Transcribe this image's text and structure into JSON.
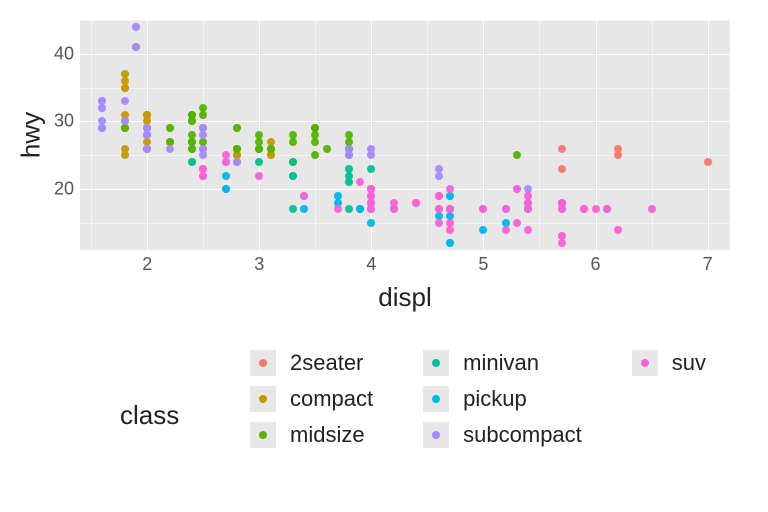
{
  "chart_data": {
    "type": "scatter",
    "title": "",
    "xlabel": "displ",
    "ylabel": "hwy",
    "xlim": [
      1.4,
      7.2
    ],
    "ylim": [
      11,
      45
    ],
    "x_breaks": [
      2,
      3,
      4,
      5,
      6,
      7
    ],
    "y_breaks": [
      20,
      30,
      40
    ],
    "legend_title": "class",
    "colors": {
      "2seater": "#F8766D",
      "compact": "#C49A00",
      "midsize": "#53B400",
      "minivan": "#00C094",
      "pickup": "#00B6EB",
      "subcompact": "#A58AFF",
      "suv": "#FB61D7"
    },
    "series": [
      {
        "name": "2seater",
        "points": [
          {
            "x": 5.7,
            "y": 26
          },
          {
            "x": 5.7,
            "y": 23
          },
          {
            "x": 6.2,
            "y": 26
          },
          {
            "x": 6.2,
            "y": 25
          },
          {
            "x": 7.0,
            "y": 24
          }
        ]
      },
      {
        "name": "compact",
        "points": [
          {
            "x": 1.8,
            "y": 29
          },
          {
            "x": 1.8,
            "y": 29
          },
          {
            "x": 2.0,
            "y": 31
          },
          {
            "x": 2.0,
            "y": 30
          },
          {
            "x": 2.8,
            "y": 26
          },
          {
            "x": 2.8,
            "y": 26
          },
          {
            "x": 3.1,
            "y": 27
          },
          {
            "x": 1.8,
            "y": 26
          },
          {
            "x": 1.8,
            "y": 25
          },
          {
            "x": 2.0,
            "y": 28
          },
          {
            "x": 2.0,
            "y": 27
          },
          {
            "x": 2.8,
            "y": 25
          },
          {
            "x": 2.8,
            "y": 25
          },
          {
            "x": 3.1,
            "y": 25
          },
          {
            "x": 3.1,
            "y": 25
          },
          {
            "x": 2.4,
            "y": 24
          },
          {
            "x": 3.3,
            "y": 24
          },
          {
            "x": 2.0,
            "y": 26
          },
          {
            "x": 2.0,
            "y": 29
          },
          {
            "x": 2.0,
            "y": 29
          },
          {
            "x": 2.0,
            "y": 29
          },
          {
            "x": 2.0,
            "y": 28
          },
          {
            "x": 2.8,
            "y": 24
          },
          {
            "x": 1.9,
            "y": 44
          },
          {
            "x": 2.0,
            "y": 29
          },
          {
            "x": 2.0,
            "y": 26
          },
          {
            "x": 2.5,
            "y": 29
          },
          {
            "x": 1.8,
            "y": 29
          },
          {
            "x": 1.8,
            "y": 29
          },
          {
            "x": 1.8,
            "y": 30
          },
          {
            "x": 1.8,
            "y": 31
          },
          {
            "x": 2.0,
            "y": 26
          },
          {
            "x": 2.8,
            "y": 29
          },
          {
            "x": 1.9,
            "y": 41
          },
          {
            "x": 2.8,
            "y": 26
          },
          {
            "x": 2.2,
            "y": 27
          },
          {
            "x": 2.2,
            "y": 29
          },
          {
            "x": 2.4,
            "y": 31
          },
          {
            "x": 2.4,
            "y": 30
          },
          {
            "x": 3.0,
            "y": 26
          },
          {
            "x": 1.8,
            "y": 35
          },
          {
            "x": 1.8,
            "y": 36
          },
          {
            "x": 1.8,
            "y": 37
          },
          {
            "x": 1.8,
            "y": 35
          },
          {
            "x": 2.0,
            "y": 31
          },
          {
            "x": 2.0,
            "y": 31
          }
        ]
      },
      {
        "name": "midsize",
        "points": [
          {
            "x": 2.4,
            "y": 27
          },
          {
            "x": 2.4,
            "y": 30
          },
          {
            "x": 3.1,
            "y": 26
          },
          {
            "x": 3.5,
            "y": 29
          },
          {
            "x": 3.6,
            "y": 26
          },
          {
            "x": 2.4,
            "y": 26
          },
          {
            "x": 2.4,
            "y": 27
          },
          {
            "x": 2.4,
            "y": 28
          },
          {
            "x": 3.8,
            "y": 26
          },
          {
            "x": 3.8,
            "y": 28
          },
          {
            "x": 2.5,
            "y": 27
          },
          {
            "x": 2.5,
            "y": 26
          },
          {
            "x": 3.3,
            "y": 28
          },
          {
            "x": 2.5,
            "y": 31
          },
          {
            "x": 2.5,
            "y": 32
          },
          {
            "x": 3.0,
            "y": 27
          },
          {
            "x": 3.5,
            "y": 25
          },
          {
            "x": 3.0,
            "y": 26
          },
          {
            "x": 3.3,
            "y": 27
          },
          {
            "x": 2.2,
            "y": 29
          },
          {
            "x": 2.2,
            "y": 27
          },
          {
            "x": 2.4,
            "y": 31
          },
          {
            "x": 2.4,
            "y": 31
          },
          {
            "x": 3.0,
            "y": 26
          },
          {
            "x": 3.0,
            "y": 28
          },
          {
            "x": 3.5,
            "y": 28
          },
          {
            "x": 3.5,
            "y": 27
          },
          {
            "x": 2.8,
            "y": 26
          },
          {
            "x": 2.8,
            "y": 26
          },
          {
            "x": 2.8,
            "y": 29
          },
          {
            "x": 3.5,
            "y": 29
          },
          {
            "x": 5.3,
            "y": 25
          },
          {
            "x": 3.8,
            "y": 26
          },
          {
            "x": 3.8,
            "y": 25
          },
          {
            "x": 3.8,
            "y": 27
          },
          {
            "x": 1.8,
            "y": 29
          },
          {
            "x": 2.0,
            "y": 29
          },
          {
            "x": 2.4,
            "y": 27
          },
          {
            "x": 3.1,
            "y": 26
          },
          {
            "x": 3.5,
            "y": 29
          },
          {
            "x": 2.4,
            "y": 26
          }
        ]
      },
      {
        "name": "minivan",
        "points": [
          {
            "x": 2.4,
            "y": 24
          },
          {
            "x": 3.0,
            "y": 24
          },
          {
            "x": 3.3,
            "y": 22
          },
          {
            "x": 3.3,
            "y": 22
          },
          {
            "x": 3.3,
            "y": 24
          },
          {
            "x": 3.8,
            "y": 22
          },
          {
            "x": 3.8,
            "y": 21
          },
          {
            "x": 3.8,
            "y": 23
          },
          {
            "x": 4.0,
            "y": 23
          },
          {
            "x": 3.3,
            "y": 17
          },
          {
            "x": 3.8,
            "y": 17
          }
        ]
      },
      {
        "name": "pickup",
        "points": [
          {
            "x": 3.7,
            "y": 19
          },
          {
            "x": 3.7,
            "y": 18
          },
          {
            "x": 3.9,
            "y": 17
          },
          {
            "x": 3.9,
            "y": 17
          },
          {
            "x": 4.7,
            "y": 19
          },
          {
            "x": 4.7,
            "y": 19
          },
          {
            "x": 4.7,
            "y": 12
          },
          {
            "x": 5.2,
            "y": 17
          },
          {
            "x": 5.2,
            "y": 15
          },
          {
            "x": 5.7,
            "y": 17
          },
          {
            "x": 5.9,
            "y": 17
          },
          {
            "x": 4.7,
            "y": 16
          },
          {
            "x": 4.7,
            "y": 12
          },
          {
            "x": 4.7,
            "y": 17
          },
          {
            "x": 5.7,
            "y": 18
          },
          {
            "x": 6.1,
            "y": 17
          },
          {
            "x": 4.0,
            "y": 17
          },
          {
            "x": 4.0,
            "y": 20
          },
          {
            "x": 4.6,
            "y": 16
          },
          {
            "x": 5.0,
            "y": 14
          },
          {
            "x": 5.4,
            "y": 17
          },
          {
            "x": 2.7,
            "y": 20
          },
          {
            "x": 2.7,
            "y": 22
          },
          {
            "x": 2.7,
            "y": 20
          },
          {
            "x": 3.4,
            "y": 17
          },
          {
            "x": 3.4,
            "y": 19
          },
          {
            "x": 4.0,
            "y": 20
          },
          {
            "x": 4.0,
            "y": 15
          },
          {
            "x": 4.0,
            "y": 18
          },
          {
            "x": 5.4,
            "y": 18
          },
          {
            "x": 5.4,
            "y": 17
          },
          {
            "x": 4.7,
            "y": 17
          },
          {
            "x": 4.2,
            "y": 17
          }
        ]
      },
      {
        "name": "subcompact",
        "points": [
          {
            "x": 3.8,
            "y": 26
          },
          {
            "x": 3.8,
            "y": 25
          },
          {
            "x": 4.0,
            "y": 26
          },
          {
            "x": 4.0,
            "y": 25
          },
          {
            "x": 4.6,
            "y": 23
          },
          {
            "x": 4.6,
            "y": 22
          },
          {
            "x": 5.4,
            "y": 20
          },
          {
            "x": 1.6,
            "y": 33
          },
          {
            "x": 1.6,
            "y": 32
          },
          {
            "x": 1.6,
            "y": 32
          },
          {
            "x": 1.6,
            "y": 29
          },
          {
            "x": 2.0,
            "y": 28
          },
          {
            "x": 2.0,
            "y": 26
          },
          {
            "x": 2.0,
            "y": 29
          },
          {
            "x": 2.2,
            "y": 26
          },
          {
            "x": 2.5,
            "y": 26
          },
          {
            "x": 2.5,
            "y": 28
          },
          {
            "x": 1.8,
            "y": 30
          },
          {
            "x": 1.8,
            "y": 33
          },
          {
            "x": 2.5,
            "y": 25
          },
          {
            "x": 2.5,
            "y": 23
          },
          {
            "x": 2.0,
            "y": 28
          },
          {
            "x": 2.7,
            "y": 24
          },
          {
            "x": 1.6,
            "y": 33
          },
          {
            "x": 1.6,
            "y": 29
          },
          {
            "x": 1.6,
            "y": 29
          },
          {
            "x": 1.6,
            "y": 30
          },
          {
            "x": 2.0,
            "y": 29
          },
          {
            "x": 2.5,
            "y": 29
          },
          {
            "x": 2.5,
            "y": 29
          },
          {
            "x": 2.8,
            "y": 24
          },
          {
            "x": 1.9,
            "y": 44
          },
          {
            "x": 1.9,
            "y": 41
          },
          {
            "x": 2.0,
            "y": 29
          },
          {
            "x": 2.0,
            "y": 26
          }
        ]
      },
      {
        "name": "suv",
        "points": [
          {
            "x": 5.3,
            "y": 20
          },
          {
            "x": 5.3,
            "y": 15
          },
          {
            "x": 5.3,
            "y": 20
          },
          {
            "x": 5.7,
            "y": 17
          },
          {
            "x": 6.0,
            "y": 17
          },
          {
            "x": 5.7,
            "y": 18
          },
          {
            "x": 5.7,
            "y": 12
          },
          {
            "x": 6.2,
            "y": 14
          },
          {
            "x": 3.9,
            "y": 21
          },
          {
            "x": 4.7,
            "y": 17
          },
          {
            "x": 4.7,
            "y": 17
          },
          {
            "x": 4.7,
            "y": 17
          },
          {
            "x": 5.2,
            "y": 14
          },
          {
            "x": 5.2,
            "y": 17
          },
          {
            "x": 5.7,
            "y": 13
          },
          {
            "x": 5.9,
            "y": 17
          },
          {
            "x": 4.7,
            "y": 17
          },
          {
            "x": 4.7,
            "y": 17
          },
          {
            "x": 4.7,
            "y": 17
          },
          {
            "x": 5.7,
            "y": 18
          },
          {
            "x": 5.9,
            "y": 17
          },
          {
            "x": 4.0,
            "y": 17
          },
          {
            "x": 4.0,
            "y": 19
          },
          {
            "x": 4.6,
            "y": 19
          },
          {
            "x": 5.0,
            "y": 17
          },
          {
            "x": 4.2,
            "y": 18
          },
          {
            "x": 4.4,
            "y": 18
          },
          {
            "x": 4.6,
            "y": 17
          },
          {
            "x": 3.0,
            "y": 22
          },
          {
            "x": 3.7,
            "y": 17
          },
          {
            "x": 4.0,
            "y": 18
          },
          {
            "x": 4.7,
            "y": 14
          },
          {
            "x": 4.7,
            "y": 15
          },
          {
            "x": 5.7,
            "y": 13
          },
          {
            "x": 4.0,
            "y": 19
          },
          {
            "x": 4.0,
            "y": 19
          },
          {
            "x": 4.6,
            "y": 15
          },
          {
            "x": 5.0,
            "y": 17
          },
          {
            "x": 5.4,
            "y": 17
          },
          {
            "x": 5.4,
            "y": 18
          },
          {
            "x": 6.5,
            "y": 17
          },
          {
            "x": 2.5,
            "y": 22
          },
          {
            "x": 2.5,
            "y": 22
          },
          {
            "x": 2.5,
            "y": 23
          },
          {
            "x": 2.5,
            "y": 23
          },
          {
            "x": 2.7,
            "y": 25
          },
          {
            "x": 2.7,
            "y": 24
          },
          {
            "x": 3.4,
            "y": 19
          },
          {
            "x": 4.0,
            "y": 20
          },
          {
            "x": 4.7,
            "y": 17
          },
          {
            "x": 4.7,
            "y": 17
          },
          {
            "x": 4.7,
            "y": 20
          },
          {
            "x": 5.7,
            "y": 18
          },
          {
            "x": 6.1,
            "y": 17
          },
          {
            "x": 4.0,
            "y": 20
          },
          {
            "x": 4.2,
            "y": 17
          },
          {
            "x": 4.4,
            "y": 18
          },
          {
            "x": 4.6,
            "y": 17
          },
          {
            "x": 5.4,
            "y": 19
          },
          {
            "x": 5.4,
            "y": 14
          },
          {
            "x": 4.0,
            "y": 18
          },
          {
            "x": 4.6,
            "y": 19
          }
        ]
      }
    ],
    "legend_columns": [
      [
        "2seater",
        "compact",
        "midsize"
      ],
      [
        "minivan",
        "pickup",
        "subcompact"
      ],
      [
        "suv"
      ]
    ]
  }
}
